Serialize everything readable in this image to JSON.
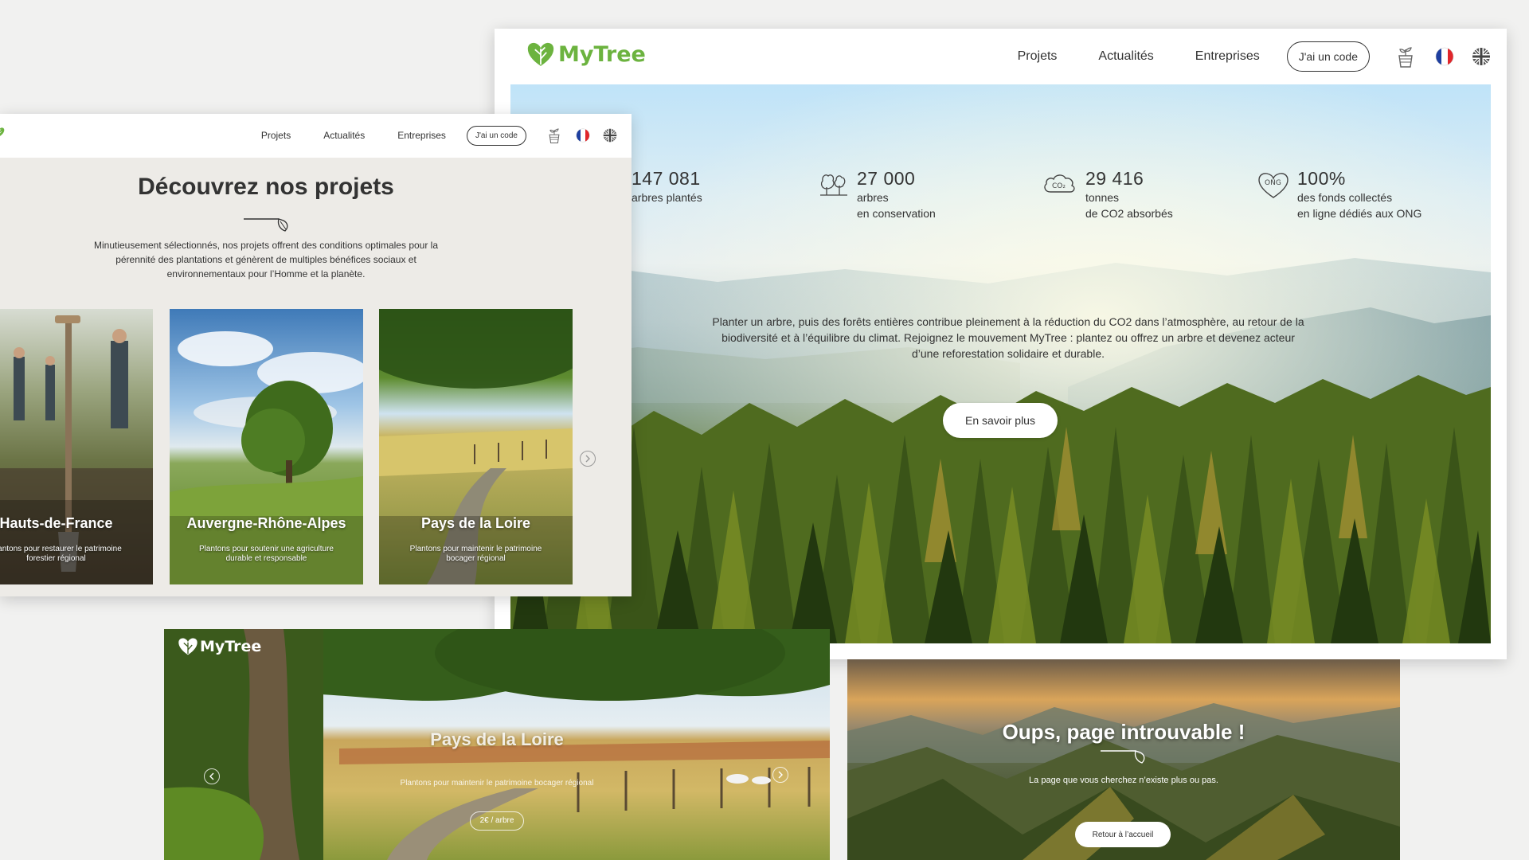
{
  "brand": {
    "name": "MyTree",
    "accent": "#6cb33f"
  },
  "nav": {
    "links": [
      "Projets",
      "Actualités",
      "Entreprises"
    ],
    "code_button": "J'ai un code",
    "icons": [
      "tree-pot-icon",
      "france-flag-icon",
      "uk-flag-icon"
    ]
  },
  "main_window": {
    "stats": [
      {
        "number": "147 081",
        "line1": "arbres plantés",
        "line2": "",
        "icon": "tree-icon"
      },
      {
        "number": "27 000",
        "line1": "arbres",
        "line2": "en conservation",
        "icon": "forest-icon"
      },
      {
        "number": "29 416",
        "line1": "tonnes",
        "line2": "de CO2 absorbés",
        "icon": "co2-cloud-icon"
      },
      {
        "number": "100%",
        "line1": "des fonds collectés",
        "line2": "en ligne dédiés aux ONG",
        "icon": "ong-heart-icon"
      }
    ],
    "hero_text": "Planter un arbre, puis des forêts entières contribue pleinement à la réduction du CO2 dans l’atmosphère, au retour de la biodiversité et à l’équilibre du climat. Rejoignez le mouvement MyTree : plantez ou offrez un arbre et devenez acteur d’une reforestation solidaire et durable.",
    "hero_button": "En savoir plus"
  },
  "projects_window": {
    "title": "Découvrez nos projets",
    "description": "Minutieusement sélectionnés, nos projets offrent des conditions optimales pour la pérennité des plantations et génèrent de multiples bénéfices sociaux et environnementaux pour l’Homme et la planète.",
    "cards": [
      {
        "title": "Hauts-de-France",
        "subtitle": "Plantons pour restaurer le patrimoine forestier régional"
      },
      {
        "title": "Auvergne-Rhône-Alpes",
        "subtitle": "Plantons pour soutenir une agriculture durable et responsable"
      },
      {
        "title": "Pays de la Loire",
        "subtitle": "Plantons pour maintenir le patrimoine bocager régional"
      }
    ]
  },
  "slider_window": {
    "title": "Pays de la Loire",
    "subtitle": "Plantons pour maintenir le patrimoine bocager régional",
    "price": "2€ / arbre"
  },
  "error_window": {
    "title": "Oups, page introuvable !",
    "subtitle": "La page que vous cherchez n’existe plus ou pas.",
    "button": "Retour à l’accueil"
  }
}
